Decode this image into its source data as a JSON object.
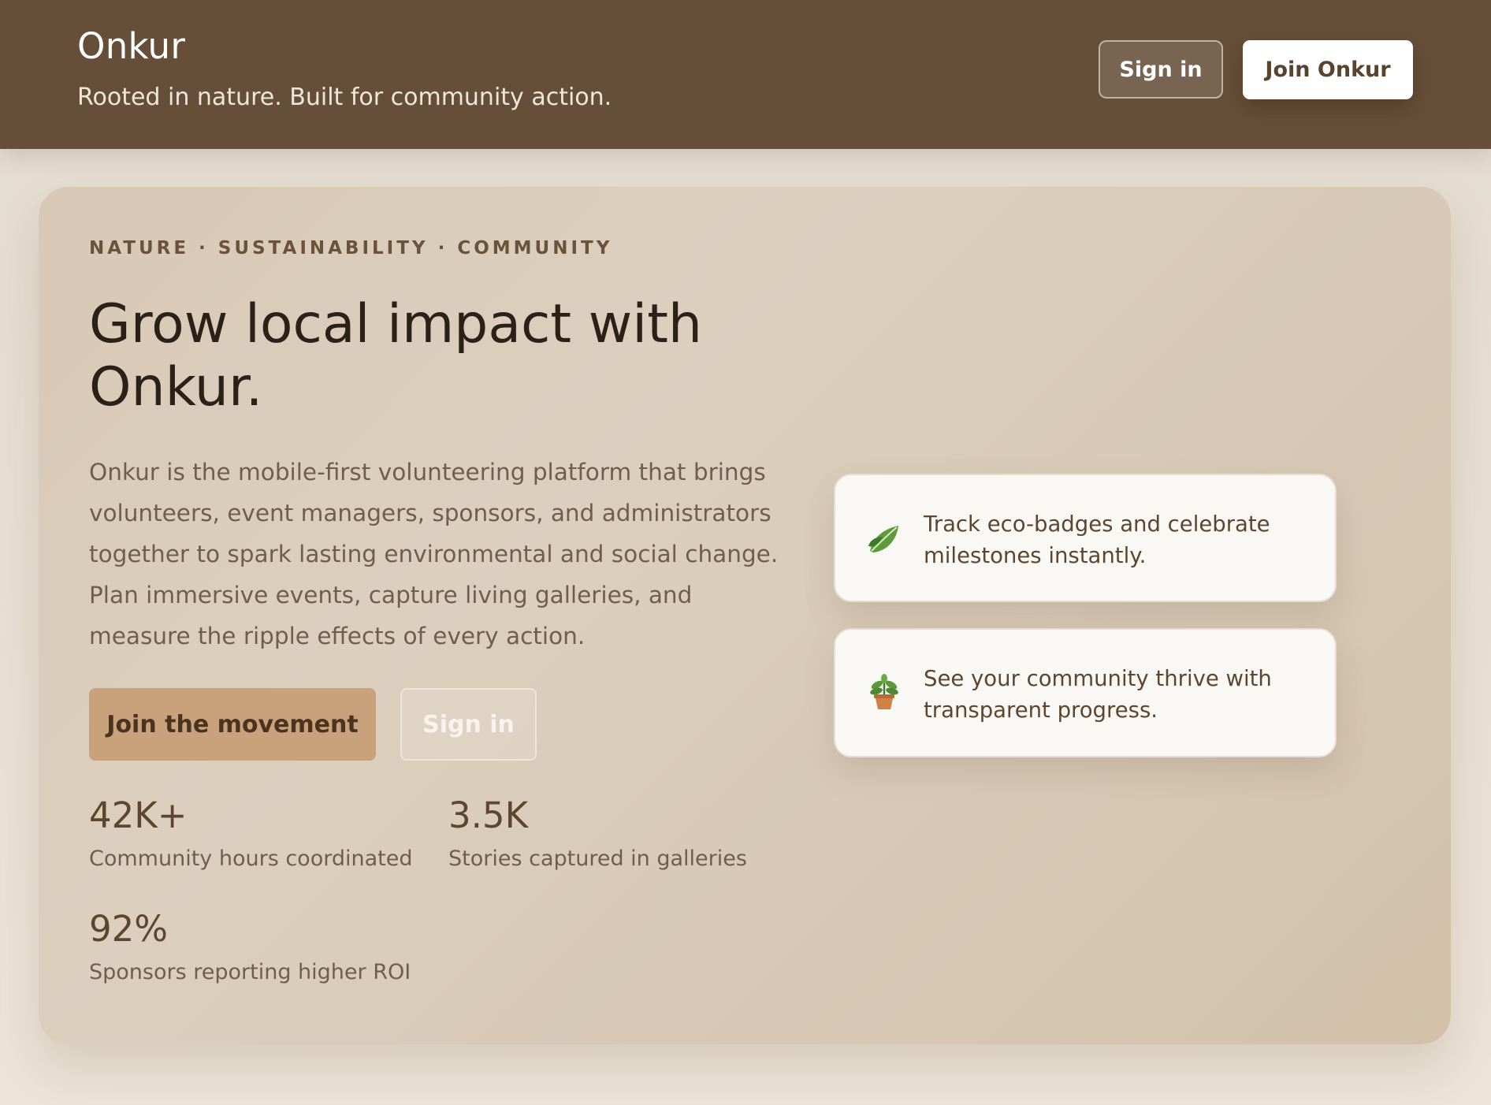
{
  "header": {
    "title": "Onkur",
    "tagline": "Rooted in nature. Built for community action.",
    "signin_label": "Sign in",
    "join_label": "Join Onkur"
  },
  "hero": {
    "eyebrow": "NATURE · SUSTAINABILITY · COMMUNITY",
    "headline": "Grow local impact with Onkur.",
    "description": "Onkur is the mobile-first volunteering platform that brings volunteers, event managers, sponsors, and administrators together to spark lasting environmental and social change. Plan immersive events, capture living galleries, and measure the ripple effects of every action.",
    "primary_cta": "Join the movement",
    "secondary_cta": "Sign in",
    "stats": [
      {
        "value": "42K+",
        "label": "Community hours coordinated"
      },
      {
        "value": "3.5K",
        "label": "Stories captured in galleries"
      },
      {
        "value": "92%",
        "label": "Sponsors reporting higher ROI"
      }
    ]
  },
  "features": [
    {
      "icon": "leaf-icon",
      "text": "Track eco-badges and celebrate milestones instantly."
    },
    {
      "icon": "potted-plant-icon",
      "text": "See your community thrive with transparent progress."
    }
  ],
  "colors": {
    "header_bg": "#664f38",
    "primary_button": "#c9a27c",
    "text_brown": "#5d4630",
    "card_bg": "#d8c9b6"
  }
}
